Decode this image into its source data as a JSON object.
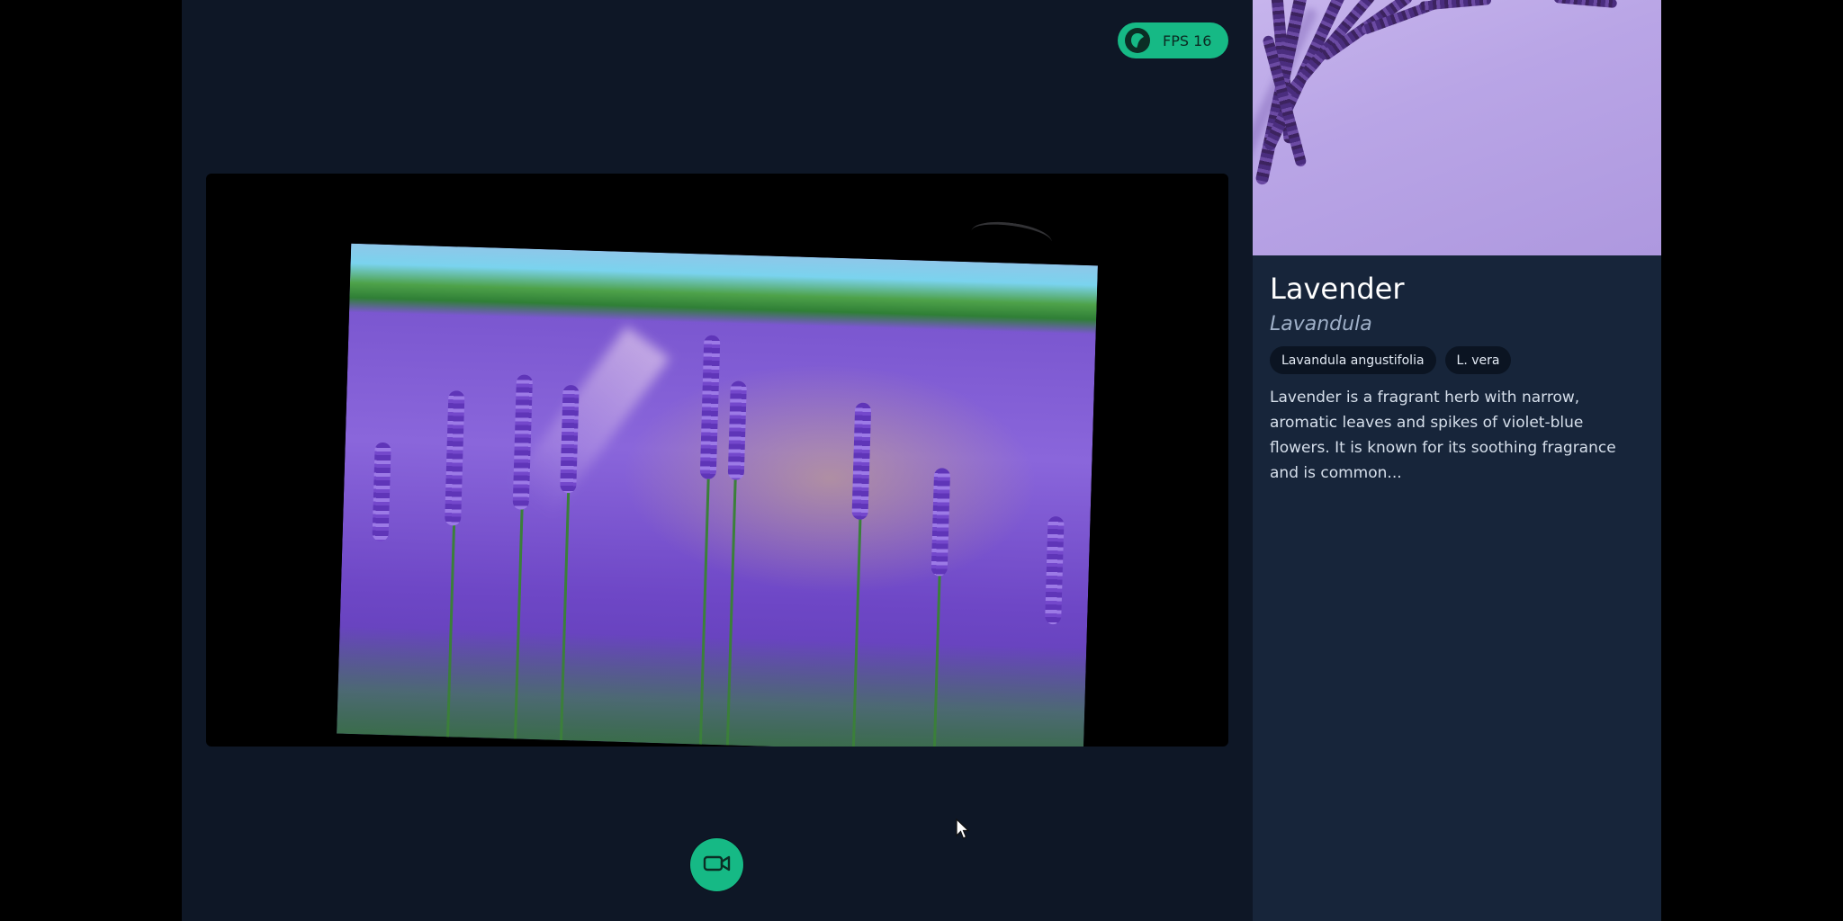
{
  "status": {
    "fps_label": "FPS 16",
    "logo_icon": "leaf-logo-icon"
  },
  "camera": {
    "record_icon": "video-camera-icon"
  },
  "plant": {
    "name": "Lavender",
    "latin": "Lavandula",
    "synonyms": [
      "Lavandula angustifolia",
      "L. vera"
    ],
    "description": "Lavender is a fragrant herb with narrow, aromatic leaves and spikes of violet-blue flowers. It is known for its soothing fragrance and is common..."
  },
  "colors": {
    "accent": "#16b985",
    "app_background": "#0e1726",
    "panel_background": "#17253a"
  }
}
